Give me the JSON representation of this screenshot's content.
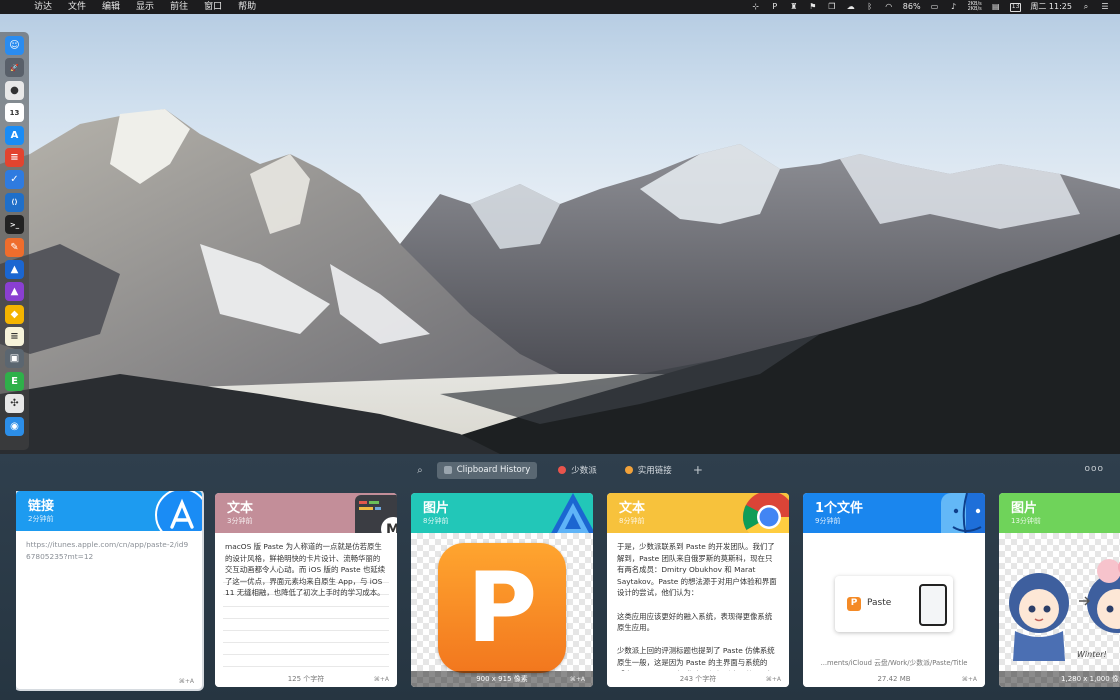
{
  "menubar": {
    "apple": "",
    "items": [
      "访达",
      "文件",
      "编辑",
      "显示",
      "前往",
      "窗口",
      "帮助"
    ],
    "status": {
      "battery": "86%",
      "net_up": "2KB/s",
      "net_down": "2KB/s",
      "date_badge": "13",
      "clock": "周二 11:25"
    }
  },
  "dock": {
    "apps": [
      {
        "name": "finder",
        "color": "#2a8cf0",
        "glyph": "☺"
      },
      {
        "name": "launchpad",
        "color": "#59606a",
        "glyph": "🚀"
      },
      {
        "name": "chrome",
        "color": "#e8e8e8",
        "glyph": "●"
      },
      {
        "name": "calendar",
        "color": "#ffffff",
        "glyph": "13"
      },
      {
        "name": "app-store",
        "color": "#1a8cf5",
        "glyph": "A"
      },
      {
        "name": "todoist",
        "color": "#e2442f",
        "glyph": "≡"
      },
      {
        "name": "task",
        "color": "#2f7be0",
        "glyph": "✓"
      },
      {
        "name": "vscode",
        "color": "#1f6fc9",
        "glyph": "⟨⟩"
      },
      {
        "name": "terminal",
        "color": "#222222",
        "glyph": ">_"
      },
      {
        "name": "sketchbook",
        "color": "#ef6d2c",
        "glyph": "✎"
      },
      {
        "name": "affinity-designer",
        "color": "#1b66d1",
        "glyph": "▲"
      },
      {
        "name": "affinity-photo",
        "color": "#8a3fd1",
        "glyph": "▲"
      },
      {
        "name": "sketch",
        "color": "#f4b400",
        "glyph": "◆"
      },
      {
        "name": "notes",
        "color": "#f7f3da",
        "glyph": "≡"
      },
      {
        "name": "screenshot",
        "color": "#5b6670",
        "glyph": "▣"
      },
      {
        "name": "evernote",
        "color": "#2fb04a",
        "glyph": "E"
      },
      {
        "name": "davinci",
        "color": "#e7e7e7",
        "glyph": "✣"
      },
      {
        "name": "paste",
        "color": "#2c8ee8",
        "glyph": "◉"
      }
    ]
  },
  "paste": {
    "search_icon": "magnifier",
    "tabs": [
      {
        "label": "Clipboard History",
        "color": "#9aa5ae",
        "active": true
      },
      {
        "label": "少数派",
        "color": "#e9544c",
        "active": false
      },
      {
        "label": "实用链接",
        "color": "#f2a23a",
        "active": false
      }
    ],
    "add_label": "+",
    "more_label": "ooo",
    "cards": [
      {
        "type": "链接",
        "time": "2分钟前",
        "header_color": "#1d9bf0",
        "app_icon": "app-store-icon",
        "content": "https://itunes.apple.com/cn/app/paste-2/id967805235?mt=12",
        "footer": "",
        "shortcut": "⌘+A"
      },
      {
        "type": "文本",
        "time": "3分钟前",
        "header_color": "#c38e99",
        "app_icon": "mweb-icon",
        "content": "macOS 版 Paste 为人称道的一点就是仿若原生的设计风格，鲜艳明快的卡片设计、流畅华丽的交互动画都令人心动。而 iOS 版的 Paste 也延续了这一优点，界面元素均来自原生 App，与 iOS 11 无缝相融，也降低了初次上手时的学习成本。",
        "footer": "125 个字符",
        "shortcut": "⌘+A"
      },
      {
        "type": "图片",
        "time": "8分钟前",
        "header_color": "#22c7b8",
        "app_icon": "affinity-designer-icon",
        "content": "",
        "image_label": "P",
        "footer": "900 x 915 像素",
        "shortcut": "⌘+A"
      },
      {
        "type": "文本",
        "time": "8分钟前",
        "header_color": "#f7c23c",
        "app_icon": "chrome-icon",
        "content": "于是，少数派联系到 Paste 的开发团队。我们了解到，Paste 团队来自俄罗斯的莫斯科，现在只有两名成员：Dmitry Obukhov 和 Marat Saytakov。Paste 的想法源于对用户体验和界面设计的尝试，他们认为：\n\n这类应用应该更好的融入系统，表现得更像系统原生应用。\n\n少数派上回的评测标题也提到了 Paste 仿佛系统原生一般，这是因为 Paste 的主界面与系统的「应用 Exposé」（四指向下轻扫时出现的界面）相似，而且，其这些信息中很多",
        "footer": "243 个字符",
        "shortcut": "⌘+A"
      },
      {
        "type": "1个文件",
        "time": "9分钟前",
        "header_color": "#1a86ee",
        "app_icon": "finder-icon",
        "content": "",
        "file_preview_label": "Paste",
        "file_path": "...ments/iCloud 云盘/Work/少数派/Paste/Title",
        "footer": "27.42 MB",
        "shortcut": "⌘+A"
      },
      {
        "type": "图片",
        "time": "13分钟前",
        "header_color": "#6fd35a",
        "app_icon": "image-icon",
        "content": "",
        "image_caption": "Winter!",
        "footer": "1,280 x 1,000 像",
        "shortcut": "⌘+A"
      }
    ]
  }
}
